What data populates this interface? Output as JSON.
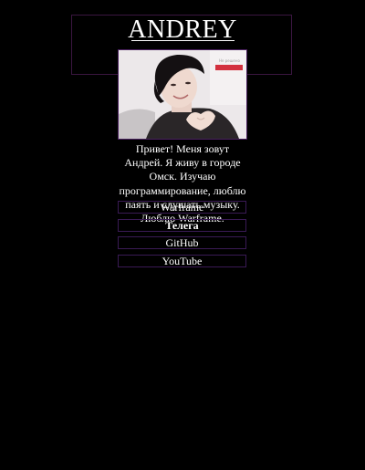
{
  "header": {
    "title": "ANDREY"
  },
  "about": {
    "bio": "Привет! Меня зовут Андрей. Я живу в городе Омск. Изучаю программирование, люблю паять и слушать музыку. Люблю Warframe.",
    "photo_overlay_text": "Не решено"
  },
  "links": [
    {
      "label": "Warframe"
    },
    {
      "label": "Телега"
    },
    {
      "label": "GitHub"
    },
    {
      "label": "YouTube"
    }
  ],
  "colors": {
    "background": "#000000",
    "text": "#ffffff",
    "border": "#3a1a55"
  }
}
